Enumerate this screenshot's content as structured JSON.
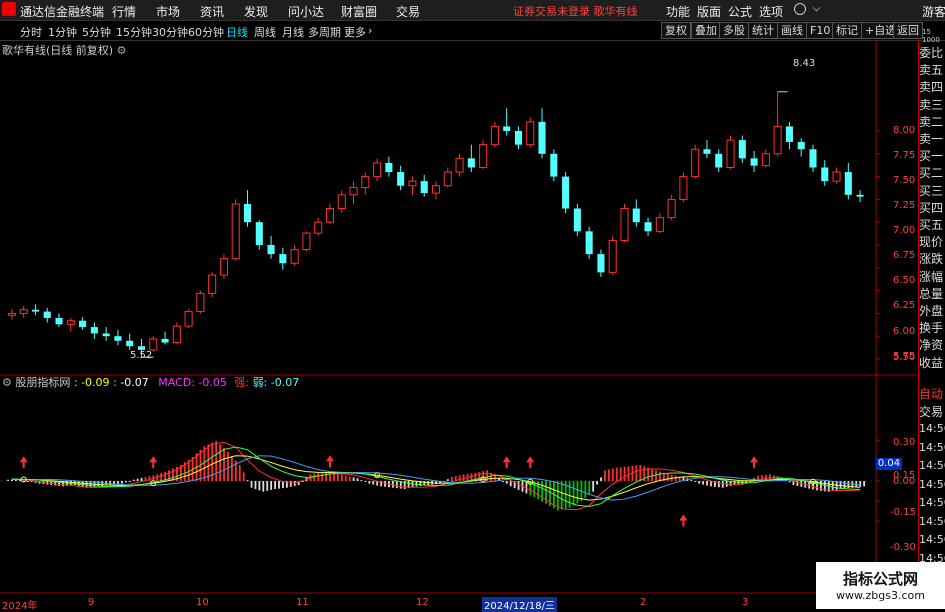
{
  "app": {
    "title": "通达信金融终端",
    "menus": [
      "行情",
      "市场",
      "资讯",
      "发现",
      "问小达",
      "财富圈",
      "交易"
    ],
    "status_text": "证券交易未登录  歌华有线",
    "right_menus": [
      "功能",
      "版面",
      "公式",
      "选项"
    ],
    "user_label": "游客"
  },
  "toolbar": {
    "periods": [
      "分时",
      "1分钟",
      "5分钟",
      "15分钟",
      "30分钟",
      "60分钟",
      "日线",
      "周线",
      "月线",
      "多周期",
      "更多"
    ],
    "active_period": "日线",
    "buttons": [
      "复权",
      "叠加",
      "多股",
      "统计",
      "画线",
      "F10",
      "标记",
      "+自选",
      "返回"
    ]
  },
  "main_chart": {
    "header": "歌华有线(日线 前复权)",
    "high_label": "8.43",
    "low_label": "5.52",
    "y_ticks": [
      "8.00",
      "7.75",
      "7.50",
      "7.25",
      "7.00",
      "6.75",
      "6.50",
      "6.25",
      "6.00",
      "5.75",
      "5.50"
    ]
  },
  "indicator": {
    "name": "股朋指标网",
    "v1": "-0.09",
    "v2": "-0.07",
    "macd_label": "MACD: -0.05",
    "strong_label": "强: ",
    "weak_label": "弱: -0.07",
    "y_ticks": [
      "0.30",
      "0.15",
      "0.00",
      "-0.15",
      "-0.30"
    ],
    "current_value": "0.04"
  },
  "right_panel": {
    "top_labels": [
      "委比",
      "卖五",
      "卖四",
      "卖三",
      "卖二",
      "卖一",
      "买一",
      "买二",
      "买三",
      "买四",
      "买五",
      "现价",
      "涨跌",
      "涨幅",
      "总量",
      "外盘",
      "换手",
      "净资",
      "收益"
    ],
    "bottom_labels": [
      "自动",
      "交易"
    ],
    "time_labels": [
      "14:56",
      "14:56",
      "14:56",
      "14:56",
      "14:56",
      "14:56",
      "14:56",
      "14:56"
    ],
    "corner_labels": [
      "15",
      "1000"
    ]
  },
  "x_axis": [
    "2024年",
    "9",
    "10",
    "11",
    "12",
    "2024/12/18/三",
    "2",
    "3"
  ],
  "watermark": {
    "line1": "指标公式网",
    "line2": "www.zbgs3.com"
  },
  "colors": {
    "up": "#ff3030",
    "down": "#54ffff",
    "axis": "#ff4040",
    "accent": "#00e5ff"
  },
  "chart_data": {
    "type": "candlestick",
    "ylim": [
      5.5,
      8.43
    ],
    "candles": [
      [
        5.98,
        6.05,
        5.93,
        6.0
      ],
      [
        6.0,
        6.08,
        5.95,
        6.04
      ],
      [
        6.04,
        6.1,
        5.98,
        6.02
      ],
      [
        6.02,
        6.06,
        5.9,
        5.95
      ],
      [
        5.95,
        6.0,
        5.85,
        5.88
      ],
      [
        5.88,
        5.95,
        5.8,
        5.92
      ],
      [
        5.92,
        5.96,
        5.82,
        5.85
      ],
      [
        5.85,
        5.9,
        5.72,
        5.78
      ],
      [
        5.78,
        5.85,
        5.7,
        5.75
      ],
      [
        5.75,
        5.82,
        5.65,
        5.7
      ],
      [
        5.7,
        5.78,
        5.6,
        5.64
      ],
      [
        5.64,
        5.72,
        5.52,
        5.6
      ],
      [
        5.6,
        5.75,
        5.58,
        5.72
      ],
      [
        5.72,
        5.8,
        5.66,
        5.68
      ],
      [
        5.68,
        5.9,
        5.66,
        5.86
      ],
      [
        5.86,
        6.05,
        5.84,
        6.02
      ],
      [
        6.02,
        6.25,
        6.0,
        6.22
      ],
      [
        6.22,
        6.45,
        6.18,
        6.42
      ],
      [
        6.42,
        6.65,
        6.38,
        6.6
      ],
      [
        6.6,
        7.25,
        6.58,
        7.2
      ],
      [
        7.2,
        7.35,
        6.95,
        7.0
      ],
      [
        7.0,
        7.02,
        6.7,
        6.75
      ],
      [
        6.75,
        6.85,
        6.6,
        6.65
      ],
      [
        6.65,
        6.72,
        6.48,
        6.55
      ],
      [
        6.55,
        6.75,
        6.52,
        6.7
      ],
      [
        6.7,
        6.9,
        6.68,
        6.88
      ],
      [
        6.88,
        7.05,
        6.85,
        7.0
      ],
      [
        7.0,
        7.2,
        6.98,
        7.15
      ],
      [
        7.15,
        7.35,
        7.1,
        7.3
      ],
      [
        7.3,
        7.45,
        7.2,
        7.38
      ],
      [
        7.38,
        7.55,
        7.3,
        7.5
      ],
      [
        7.5,
        7.7,
        7.45,
        7.65
      ],
      [
        7.65,
        7.72,
        7.5,
        7.55
      ],
      [
        7.55,
        7.62,
        7.35,
        7.4
      ],
      [
        7.4,
        7.5,
        7.3,
        7.45
      ],
      [
        7.45,
        7.52,
        7.28,
        7.32
      ],
      [
        7.32,
        7.45,
        7.25,
        7.4
      ],
      [
        7.4,
        7.6,
        7.38,
        7.55
      ],
      [
        7.55,
        7.75,
        7.5,
        7.7
      ],
      [
        7.7,
        7.85,
        7.55,
        7.6
      ],
      [
        7.6,
        7.9,
        7.58,
        7.85
      ],
      [
        7.85,
        8.1,
        7.82,
        8.05
      ],
      [
        8.05,
        8.25,
        7.95,
        8.0
      ],
      [
        8.0,
        8.05,
        7.8,
        7.85
      ],
      [
        7.85,
        8.15,
        7.82,
        8.1
      ],
      [
        8.1,
        8.25,
        7.7,
        7.75
      ],
      [
        7.75,
        7.8,
        7.45,
        7.5
      ],
      [
        7.5,
        7.55,
        7.1,
        7.15
      ],
      [
        7.15,
        7.2,
        6.85,
        6.9
      ],
      [
        6.9,
        6.95,
        6.6,
        6.65
      ],
      [
        6.65,
        6.7,
        6.4,
        6.45
      ],
      [
        6.45,
        6.85,
        6.42,
        6.8
      ],
      [
        6.8,
        7.2,
        6.78,
        7.15
      ],
      [
        7.15,
        7.25,
        6.95,
        7.0
      ],
      [
        7.0,
        7.05,
        6.85,
        6.9
      ],
      [
        6.9,
        7.1,
        6.88,
        7.05
      ],
      [
        7.05,
        7.3,
        7.02,
        7.25
      ],
      [
        7.25,
        7.55,
        7.22,
        7.5
      ],
      [
        7.5,
        7.85,
        7.48,
        7.8
      ],
      [
        7.8,
        7.9,
        7.7,
        7.75
      ],
      [
        7.75,
        7.8,
        7.55,
        7.6
      ],
      [
        7.6,
        7.95,
        7.58,
        7.9
      ],
      [
        7.9,
        7.95,
        7.65,
        7.7
      ],
      [
        7.7,
        7.78,
        7.55,
        7.62
      ],
      [
        7.62,
        7.8,
        7.6,
        7.75
      ],
      [
        7.75,
        8.43,
        7.72,
        8.05
      ],
      [
        8.05,
        8.1,
        7.8,
        7.88
      ],
      [
        7.88,
        7.92,
        7.72,
        7.8
      ],
      [
        7.8,
        7.85,
        7.55,
        7.6
      ],
      [
        7.6,
        7.68,
        7.4,
        7.45
      ],
      [
        7.45,
        7.6,
        7.42,
        7.55
      ],
      [
        7.55,
        7.65,
        7.25,
        7.3
      ],
      [
        7.3,
        7.35,
        7.22,
        7.28
      ]
    ],
    "macd_hist": [
      0.01,
      0.0,
      -0.02,
      -0.03,
      -0.04,
      -0.03,
      -0.05,
      -0.04,
      -0.03,
      -0.02,
      0.01,
      0.03,
      0.05,
      0.08,
      0.12,
      0.18,
      0.26,
      0.3,
      0.22,
      0.12,
      -0.05,
      -0.08,
      -0.06,
      -0.05,
      -0.03,
      0.05,
      0.07,
      0.06,
      0.04,
      0.02,
      -0.02,
      -0.04,
      -0.05,
      -0.06,
      -0.04,
      -0.03,
      -0.02,
      0.03,
      0.05,
      0.06,
      0.08,
      0.02,
      -0.04,
      -0.08,
      -0.12,
      -0.17,
      -0.22,
      -0.2,
      -0.15,
      -0.08,
      0.08,
      0.1,
      0.11,
      0.12,
      0.09,
      0.06,
      0.04,
      0.02,
      -0.02,
      -0.04,
      -0.05,
      -0.03,
      -0.02,
      0.04,
      0.05,
      0.03,
      -0.03,
      -0.05,
      -0.07,
      -0.08,
      -0.06,
      -0.05,
      -0.04
    ]
  }
}
